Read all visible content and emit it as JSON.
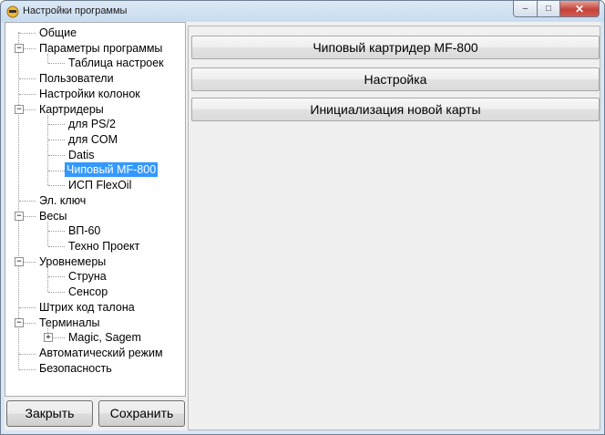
{
  "window": {
    "title": "Настройки программы",
    "controls": {
      "minimize": "–",
      "maximize": "□",
      "close": "✕"
    }
  },
  "tree": {
    "nodes": [
      {
        "label": "Общие"
      },
      {
        "label": "Параметры программы",
        "expander": "−"
      },
      {
        "label": "Таблица настроек"
      },
      {
        "label": "Пользователи"
      },
      {
        "label": "Настройки колонок"
      },
      {
        "label": "Картридеры",
        "expander": "−"
      },
      {
        "label": "для PS/2"
      },
      {
        "label": "для COM"
      },
      {
        "label": "Datis"
      },
      {
        "label": "Чиповый MF-800",
        "selected": true
      },
      {
        "label": "ИСП FlexOil"
      },
      {
        "label": "Эл. ключ"
      },
      {
        "label": "Весы",
        "expander": "−"
      },
      {
        "label": "ВП-60"
      },
      {
        "label": "Техно Проект"
      },
      {
        "label": "Уровнемеры",
        "expander": "−"
      },
      {
        "label": "Струна"
      },
      {
        "label": "Сенсор"
      },
      {
        "label": "Штрих код талона"
      },
      {
        "label": "Терминалы",
        "expander": "−"
      },
      {
        "label": "Magic, Sagem",
        "expander": "+"
      },
      {
        "label": "Автоматический режим"
      },
      {
        "label": "Безопасность"
      }
    ]
  },
  "buttons": {
    "close": "Закрыть",
    "save": "Сохранить"
  },
  "panel": {
    "buttons": [
      "Чиповый картридер MF-800",
      "Настройка",
      "Инициализация новой карты"
    ]
  },
  "colors": {
    "selection": "#3399ff",
    "close_button": "#c5423a"
  }
}
